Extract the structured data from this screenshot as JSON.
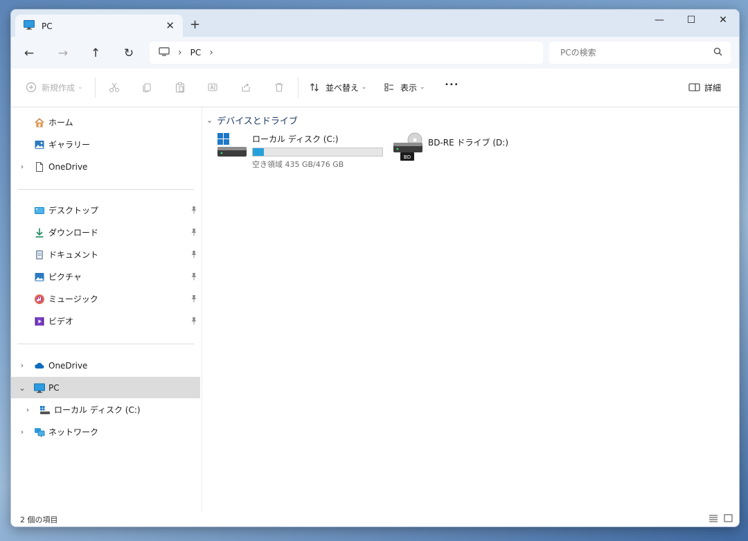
{
  "window": {
    "tab_title": "PC",
    "tab_close": "✕",
    "new_tab": "+",
    "controls": {
      "minimize": "—",
      "maximize": "☐",
      "close": "✕"
    }
  },
  "nav": {
    "back": "←",
    "forward": "→",
    "up": "↑",
    "refresh": "↻",
    "breadcrumb": [
      "PC"
    ],
    "search_placeholder": "PCの検索"
  },
  "toolbar": {
    "new_label": "新規作成",
    "sort_label": "並べ替え",
    "view_label": "表示",
    "more_label": "•••",
    "details_label": "詳細"
  },
  "sidebar": {
    "top": [
      {
        "label": "ホーム",
        "icon": "home-icon"
      },
      {
        "label": "ギャラリー",
        "icon": "gallery-icon"
      },
      {
        "label": "OneDrive",
        "icon": "document-icon",
        "expandable": true
      }
    ],
    "quick_access": [
      {
        "label": "デスクトップ",
        "icon": "desktop-icon"
      },
      {
        "label": "ダウンロード",
        "icon": "download-icon"
      },
      {
        "label": "ドキュメント",
        "icon": "documents-icon"
      },
      {
        "label": "ピクチャ",
        "icon": "pictures-icon"
      },
      {
        "label": "ミュージック",
        "icon": "music-icon"
      },
      {
        "label": "ビデオ",
        "icon": "video-icon"
      }
    ],
    "tree": [
      {
        "label": "OneDrive",
        "icon": "cloud-icon",
        "expanded": false
      },
      {
        "label": "PC",
        "icon": "pc-icon",
        "expanded": true,
        "selected": true
      },
      {
        "label": "ローカル ディスク (C:)",
        "icon": "drive-icon",
        "child": true
      },
      {
        "label": "ネットワーク",
        "icon": "network-icon",
        "expanded": false
      }
    ]
  },
  "content": {
    "group_title": "デバイスとドライブ",
    "drives": [
      {
        "name": "ローカル ディスク (C:)",
        "free_text": "空き領域 435 GB/476 GB",
        "used_fraction": 0.086
      },
      {
        "name": "BD-RE ドライブ (D:)",
        "badge": "BD"
      }
    ]
  },
  "status": {
    "count_text": "2 個の項目"
  },
  "colors": {
    "accent": "#26a0da",
    "selected_bg": "#dcdcdc",
    "tab_strip": "#dce7f3"
  }
}
